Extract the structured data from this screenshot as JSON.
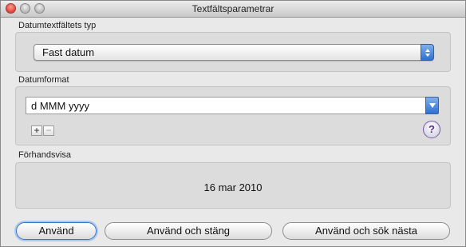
{
  "window": {
    "title": "Textfältsparametrar"
  },
  "type_group": {
    "label": "Datumtextfältets typ",
    "selected": "Fast datum"
  },
  "format_group": {
    "label": "Datumformat",
    "value": "d MMM yyyy",
    "add_label": "+",
    "remove_label": "−",
    "help_label": "?"
  },
  "preview_group": {
    "label": "Förhandsvisa",
    "value": "16 mar 2010"
  },
  "buttons": {
    "apply": "Använd",
    "apply_close": "Använd och stäng",
    "apply_next": "Använd och sök nästa"
  }
}
